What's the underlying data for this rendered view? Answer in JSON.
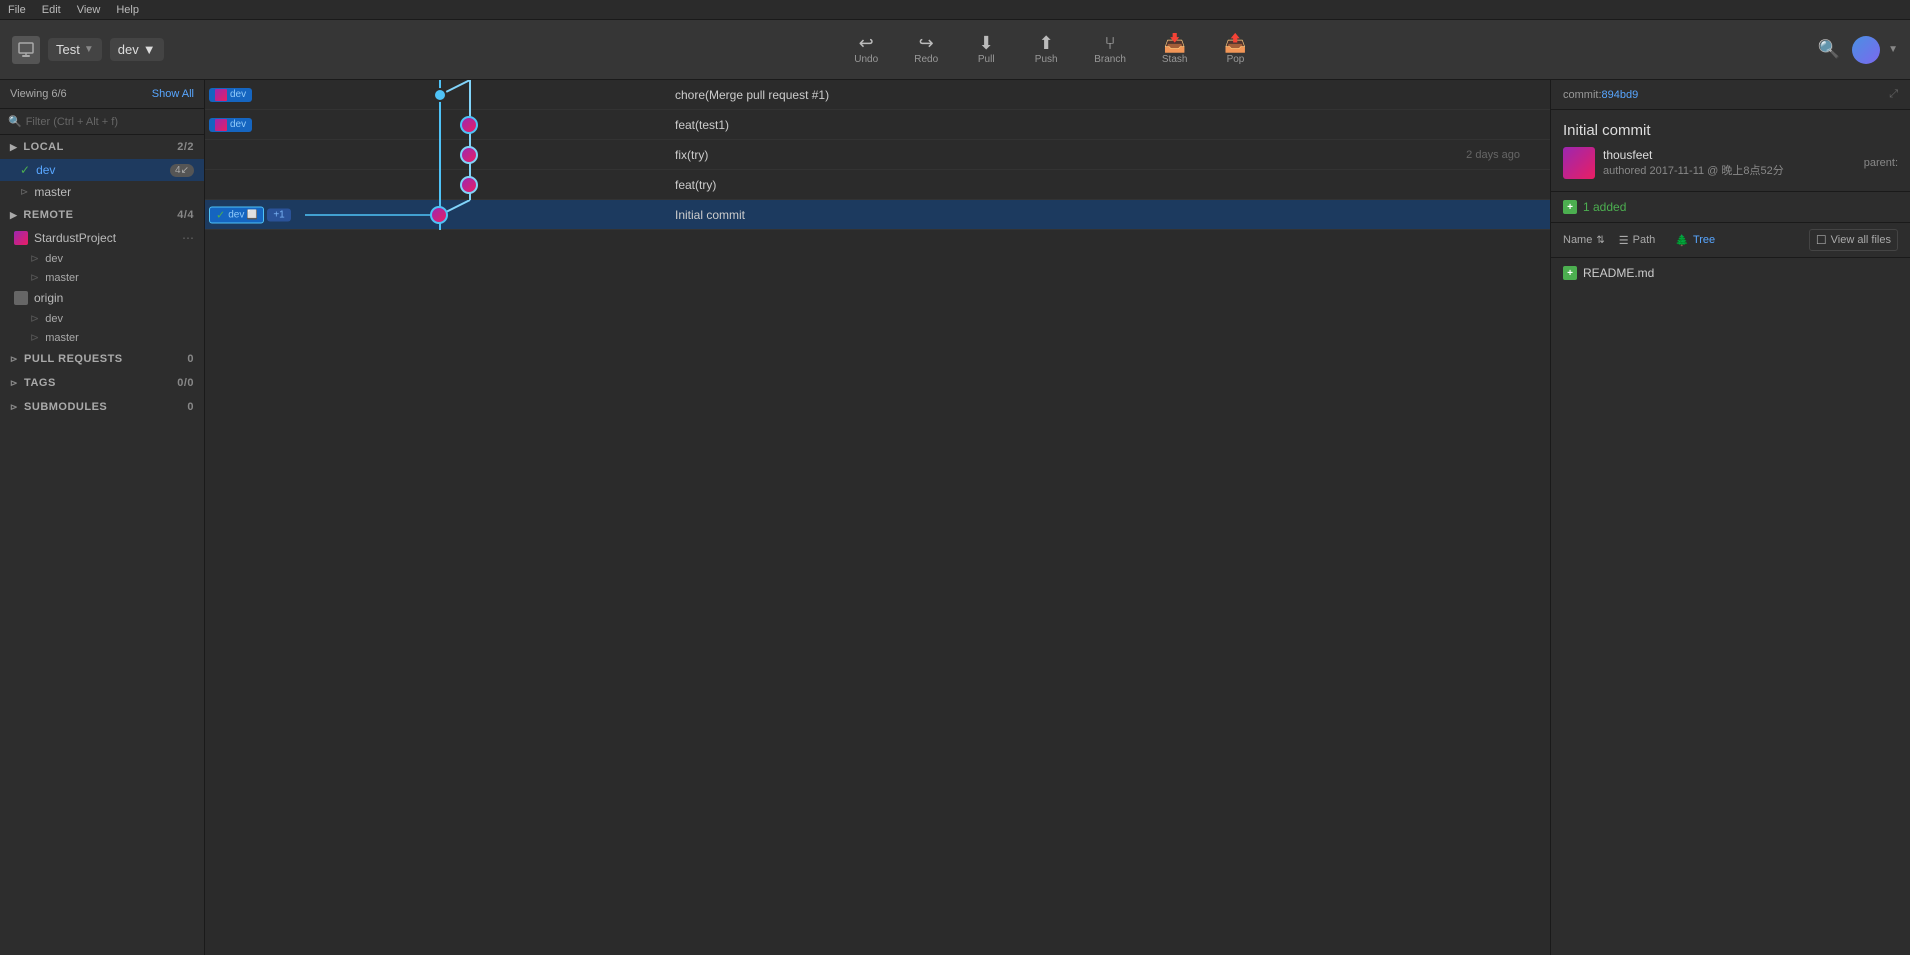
{
  "menubar": {
    "items": [
      "File",
      "Edit",
      "View",
      "Help"
    ]
  },
  "toolbar": {
    "repo_name": "Test",
    "branch_name": "dev",
    "undo_label": "Undo",
    "redo_label": "Redo",
    "pull_label": "Pull",
    "push_label": "Push",
    "branch_label": "Branch",
    "stash_label": "Stash",
    "pop_label": "Pop"
  },
  "sidebar": {
    "viewing": "Viewing 6/6",
    "show_all": "Show All",
    "filter_placeholder": "Filter (Ctrl + Alt + f)",
    "local_section": "LOCAL",
    "local_count": "2/2",
    "local_branches": [
      {
        "name": "dev",
        "active": true,
        "badge": "4↙"
      },
      {
        "name": "master",
        "active": false
      }
    ],
    "remote_section": "REMOTE",
    "remote_count": "4/4",
    "remote_groups": [
      {
        "name": "StardustProject",
        "branches": [
          "dev",
          "master"
        ]
      },
      {
        "name": "origin",
        "branches": [
          "dev",
          "master"
        ]
      }
    ],
    "pull_requests_label": "PULL REQUESTS",
    "pull_requests_count": "0",
    "tags_label": "TAGS",
    "tags_count": "0/0",
    "submodules_label": "SUBMODULES",
    "submodules_count": "0"
  },
  "commits": [
    {
      "id": "c1",
      "message": "chore(Merge pull request #1)",
      "time": "",
      "branch_tags": [
        "dev"
      ],
      "selected": false,
      "lane": 0
    },
    {
      "id": "c2",
      "message": "feat(test1)",
      "time": "",
      "branch_tags": [
        "dev"
      ],
      "selected": false,
      "lane": 1
    },
    {
      "id": "c3",
      "message": "fix(try)",
      "time": "2 days ago",
      "branch_tags": [],
      "selected": false,
      "lane": 1
    },
    {
      "id": "c4",
      "message": "feat(try)",
      "time": "",
      "branch_tags": [],
      "selected": false,
      "lane": 1
    },
    {
      "id": "c5",
      "message": "Initial commit",
      "time": "",
      "branch_tags": [
        "dev",
        "+1"
      ],
      "selected": true,
      "lane": 0
    }
  ],
  "right_panel": {
    "commit_label": "commit:",
    "commit_hash": "894bd9",
    "commit_title": "Initial commit",
    "parent_label": "parent:",
    "author_name": "thousfeet",
    "author_date": "authored 2017-11-11 @ 晚上8点52分",
    "files_added_count": "1 added",
    "view_name_label": "Name",
    "view_path_label": "Path",
    "view_tree_label": "Tree",
    "view_all_label": "View all files",
    "files": [
      {
        "name": "README.md",
        "status": "added"
      }
    ]
  }
}
